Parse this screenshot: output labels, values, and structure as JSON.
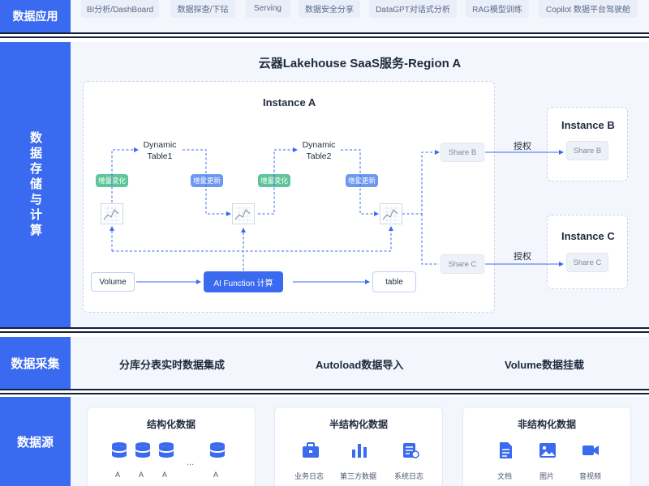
{
  "apps": {
    "label": "数据应用",
    "chips": [
      "BI分析/DashBoard",
      "数据探查/下钻",
      "Serving",
      "数据安全分享",
      "DataGPT对话式分析",
      "RAG模型训练",
      "Copilot 数据平台驾驶舱"
    ]
  },
  "storage": {
    "label": "数据存储与计算",
    "title": "云器Lakehouse SaaS服务-Region A",
    "instance_a": "Instance A",
    "instance_b": "Instance B",
    "instance_c": "Instance C",
    "dyn1": "Dynamic\nTable1",
    "dyn2": "Dynamic\nTable2",
    "tags": {
      "t1": "增量变化",
      "t2": "增量更新",
      "t3": "增量变化",
      "t4": "增量更新"
    },
    "volume": "Volume",
    "ai_function": "AI Function 计算",
    "table": "table",
    "share_b": "Share B",
    "share_c": "Share C",
    "share_b_dst": "Share B",
    "share_c_dst": "Share C",
    "auth_b": "授权",
    "auth_c": "授权"
  },
  "collect": {
    "label": "数据采集",
    "items": [
      "分库分表实时数据集成",
      "Autoload数据导入",
      "Volume数据挂载"
    ]
  },
  "source": {
    "label": "数据源",
    "structured": {
      "title": "结构化数据",
      "labels": [
        "A",
        "A",
        "A",
        "...",
        "A"
      ]
    },
    "semi": {
      "title": "半结构化数据",
      "labels": [
        "业务日志",
        "第三方数据",
        "系统日志"
      ]
    },
    "unstructured": {
      "title": "非结构化数据",
      "labels": [
        "文档",
        "图片",
        "音视频"
      ]
    }
  },
  "colors": {
    "accent": "#3a6af0",
    "band_bg": "#f3f6fc",
    "green_tag": "#5ec59a",
    "blue_tag": "#6d98f2"
  }
}
